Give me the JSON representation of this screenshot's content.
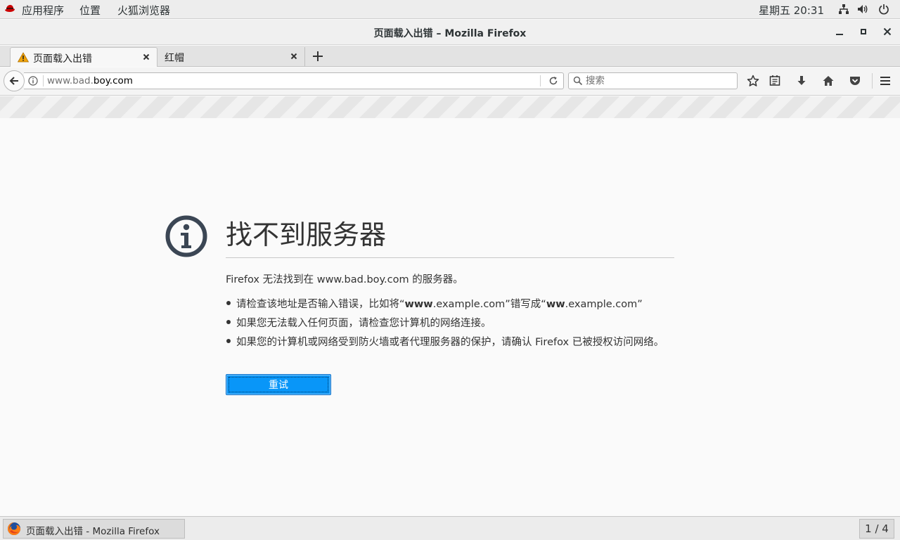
{
  "top_panel": {
    "menu_items": [
      "应用程序",
      "位置",
      "火狐浏览器"
    ],
    "clock": "星期五 20:31"
  },
  "window": {
    "title": "页面载入出错  –  Mozilla Firefox"
  },
  "tabs": [
    {
      "label": "页面载入出错",
      "icon": "warning-icon",
      "active": true
    },
    {
      "label": "红帽",
      "active": false
    }
  ],
  "navbar": {
    "url_prefix": "www.bad.",
    "url_domain": "boy.com",
    "search_placeholder": "搜索"
  },
  "error_page": {
    "title": "找不到服务器",
    "description": "Firefox 无法找到在 www.bad.boy.com 的服务器。",
    "suggestion_1_pre": "请检查该地址是否输入错误，比如将“",
    "suggestion_1_b1": "www",
    "suggestion_1_mid": ".example.com”错写成“",
    "suggestion_1_b2": "ww",
    "suggestion_1_post": ".example.com”",
    "suggestion_2": "如果您无法载入任何页面，请检查您计算机的网络连接。",
    "suggestion_3": "如果您的计算机或网络受到防火墙或者代理服务器的保护，请确认 Firefox 已被授权访问网络。",
    "retry_label": "重试"
  },
  "taskbar": {
    "task_label": "页面载入出错 - Mozilla Firefox",
    "workspace": "1 / 4"
  },
  "colors": {
    "accent": "#0996f8",
    "icon_dark": "#3b4654",
    "warning": "#f0a30a",
    "redhat": "#cc0000"
  }
}
